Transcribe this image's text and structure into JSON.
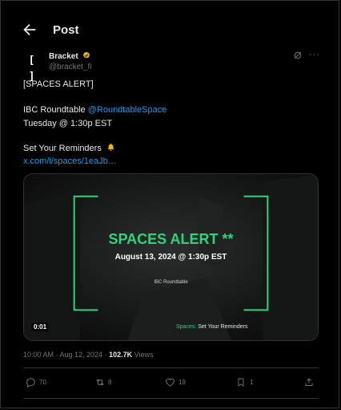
{
  "header": {
    "title": "Post",
    "back_icon": "arrow-left-icon"
  },
  "author": {
    "avatar_text": "[ ]",
    "name": "Bracket",
    "handle": "@bracket_fi",
    "verified_color": "#e2b719"
  },
  "post": {
    "line1": "[SPACES ALERT]",
    "line2_text": "IBC Roundtable ",
    "line2_mention": "@RoundtableSpace",
    "line3": "Tuesday @ 1:30p EST",
    "line4": "Set Your Reminders",
    "link": "x.com/i/spaces/1eaJb…"
  },
  "media": {
    "title": "SPACES ALERT **",
    "date": "August 13, 2024 @ 1:30p EST",
    "room": "IBC Roundtable",
    "footer_accent": "Spaces:",
    "footer_text": " Set Your Reminders",
    "duration": "0:01",
    "accent_color": "#2ed47a"
  },
  "meta": {
    "timestamp": "10:00 AM · Aug 12, 2024 · ",
    "views_count": "102.7K",
    "views_label": " Views"
  },
  "actions": {
    "replies": "70",
    "reposts": "8",
    "likes": "19",
    "bookmarks": "1"
  },
  "colors": {
    "link": "#1d9bf0",
    "muted": "#71767b",
    "text": "#e7e9ea",
    "background": "#000000"
  }
}
